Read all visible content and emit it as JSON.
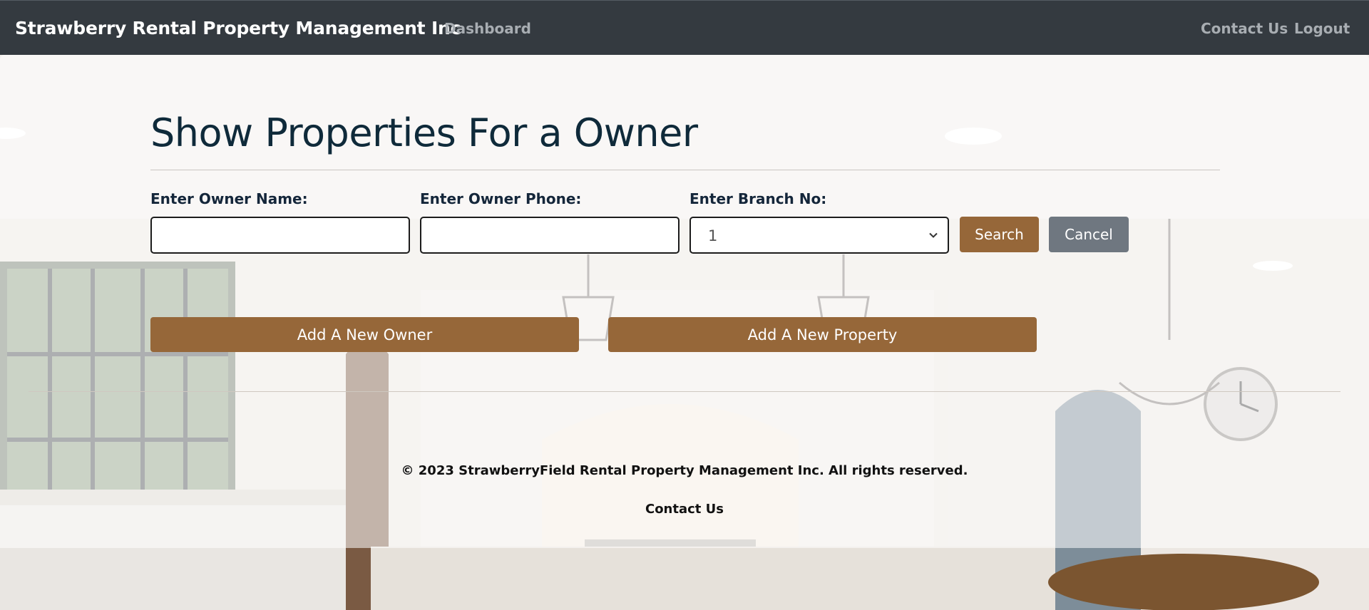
{
  "navbar": {
    "brand": "Strawberry Rental Property Management Inc",
    "dashboard_link": "Dashboard",
    "contact_link": "Contact Us",
    "logout_link": "Logout"
  },
  "page": {
    "title": "Show Properties For a Owner"
  },
  "form": {
    "owner_name_label": "Enter Owner Name:",
    "owner_name_value": "",
    "owner_phone_label": "Enter Owner Phone:",
    "owner_phone_value": "",
    "branch_label": "Enter Branch No:",
    "branch_selected": "1",
    "search_button": "Search",
    "cancel_button": "Cancel"
  },
  "actions": {
    "add_owner": "Add A New Owner",
    "add_property": "Add A New Property"
  },
  "footer": {
    "copyright": "© 2023 StrawberryField Rental Property Management Inc. All rights reserved.",
    "contact_link": "Contact Us"
  },
  "colors": {
    "navbar": "#343a40",
    "primary_button": "#966739",
    "secondary_button": "#6f7780",
    "title": "#0f2a3a"
  }
}
